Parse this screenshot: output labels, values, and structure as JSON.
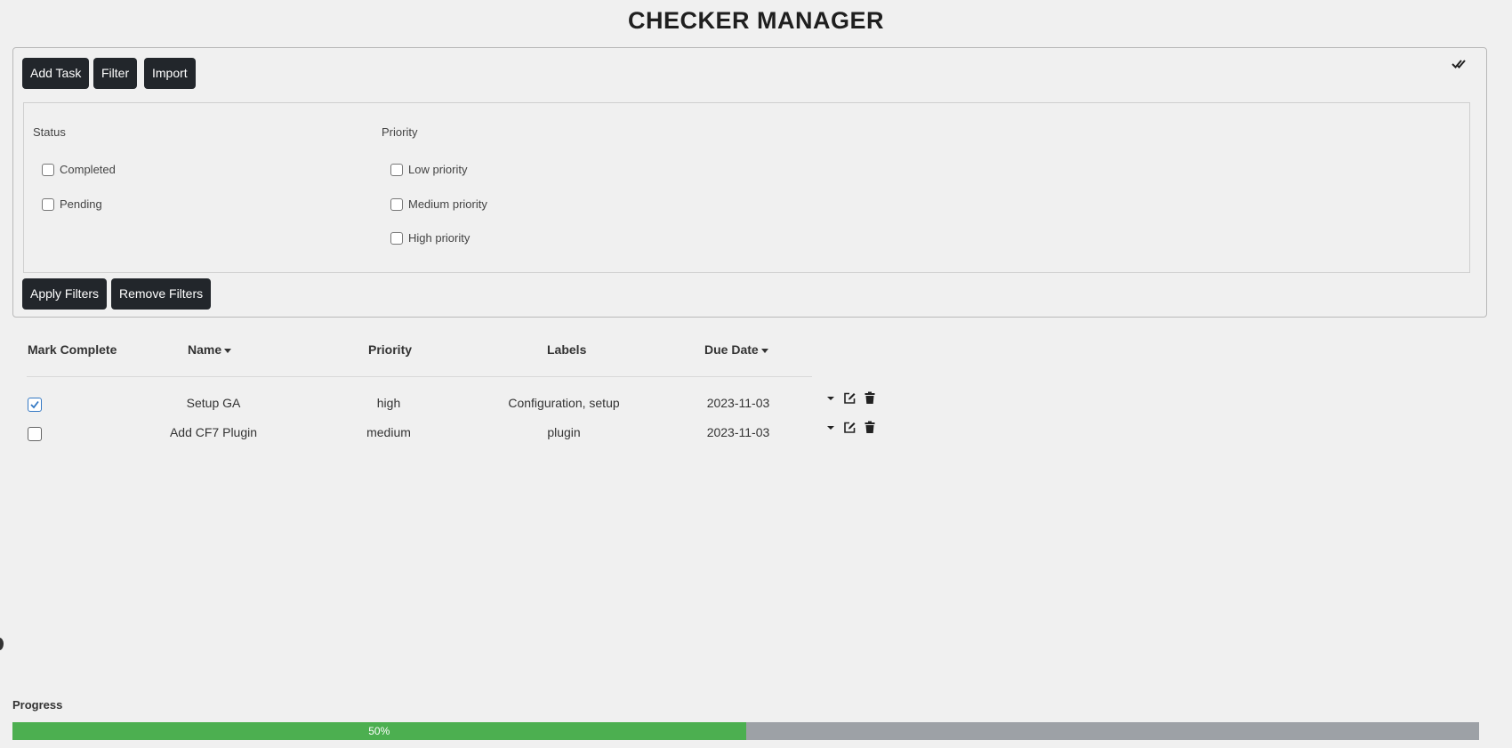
{
  "app": {
    "title": "CHECKER MANAGER"
  },
  "toolbar": {
    "add_task_label": "Add Task",
    "filter_label": "Filter",
    "import_label": "Import"
  },
  "filters": {
    "status": {
      "title": "Status",
      "options": [
        {
          "label": "Completed",
          "checked": false
        },
        {
          "label": "Pending",
          "checked": false
        }
      ]
    },
    "priority": {
      "title": "Priority",
      "options": [
        {
          "label": "Low priority",
          "checked": false
        },
        {
          "label": "Medium priority",
          "checked": false
        },
        {
          "label": "High priority",
          "checked": false
        }
      ]
    },
    "apply_label": "Apply Filters",
    "remove_label": "Remove Filters"
  },
  "table": {
    "headers": {
      "mark_complete": "Mark Complete",
      "name": "Name",
      "priority": "Priority",
      "labels": "Labels",
      "due_date": "Due Date"
    },
    "rows": [
      {
        "checked": true,
        "name": "Setup GA",
        "priority": "high",
        "labels": "Configuration, setup",
        "due_date": "2023-11-03"
      },
      {
        "checked": false,
        "name": "Add CF7 Plugin",
        "priority": "medium",
        "labels": "plugin",
        "due_date": "2023-11-03"
      }
    ]
  },
  "progress": {
    "label": "Progress",
    "value_text": "50%",
    "fraction": 0.5,
    "fill_color": "#4caf50",
    "track_color": "#9da1a6"
  },
  "icons": {
    "check_all": "double-check-icon",
    "expand": "caret-down-icon",
    "edit": "edit-icon",
    "delete": "trash-icon"
  }
}
